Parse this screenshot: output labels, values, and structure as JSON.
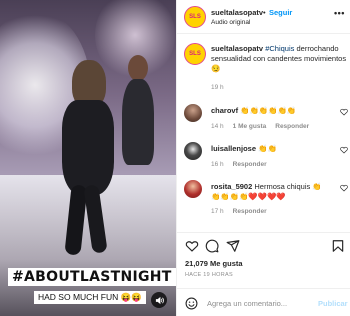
{
  "media": {
    "overlay_title": "#ABOUTLASTNIGHT",
    "overlay_subtitle": "HAD SO MUCH FUN 😝😝",
    "sound_icon": "volume-icon"
  },
  "header": {
    "username": "sueltalasopatv",
    "separator": "•",
    "follow_label": "Seguir",
    "audio_label": "Audio original",
    "more_icon_text": "•••",
    "avatar_initials": "SLS"
  },
  "caption": {
    "username": "sueltalasopatv",
    "hashtag": "#Chiquis",
    "text": " derrochando sensualidad con candentes movimientos 😏",
    "time": "19 h"
  },
  "comments": [
    {
      "username": "charovf",
      "text": "👏👏👏👏👏👏",
      "time": "14 h",
      "likes": "1 Me gusta",
      "reply": "Responder"
    },
    {
      "username": "luisallenjose",
      "text": "👏👏",
      "time": "16 h",
      "likes": "",
      "reply": "Responder"
    },
    {
      "username": "rosita_5902",
      "text": "Hermosa chiquis 👏👏👏👏👏❤️❤️❤️❤️",
      "time": "17 h",
      "likes": "",
      "reply": "Responder"
    }
  ],
  "actions": {
    "likes": "21,079 Me gusta",
    "time_ago": "HACE 19 HORAS"
  },
  "add_comment": {
    "placeholder": "Agrega un comentario...",
    "publish_label": "Publicar"
  },
  "colors": {
    "link_blue": "#0095f6",
    "muted": "#8e8e8e",
    "brand_yellow": "#ffd200",
    "brand_pink": "#d8227a"
  }
}
